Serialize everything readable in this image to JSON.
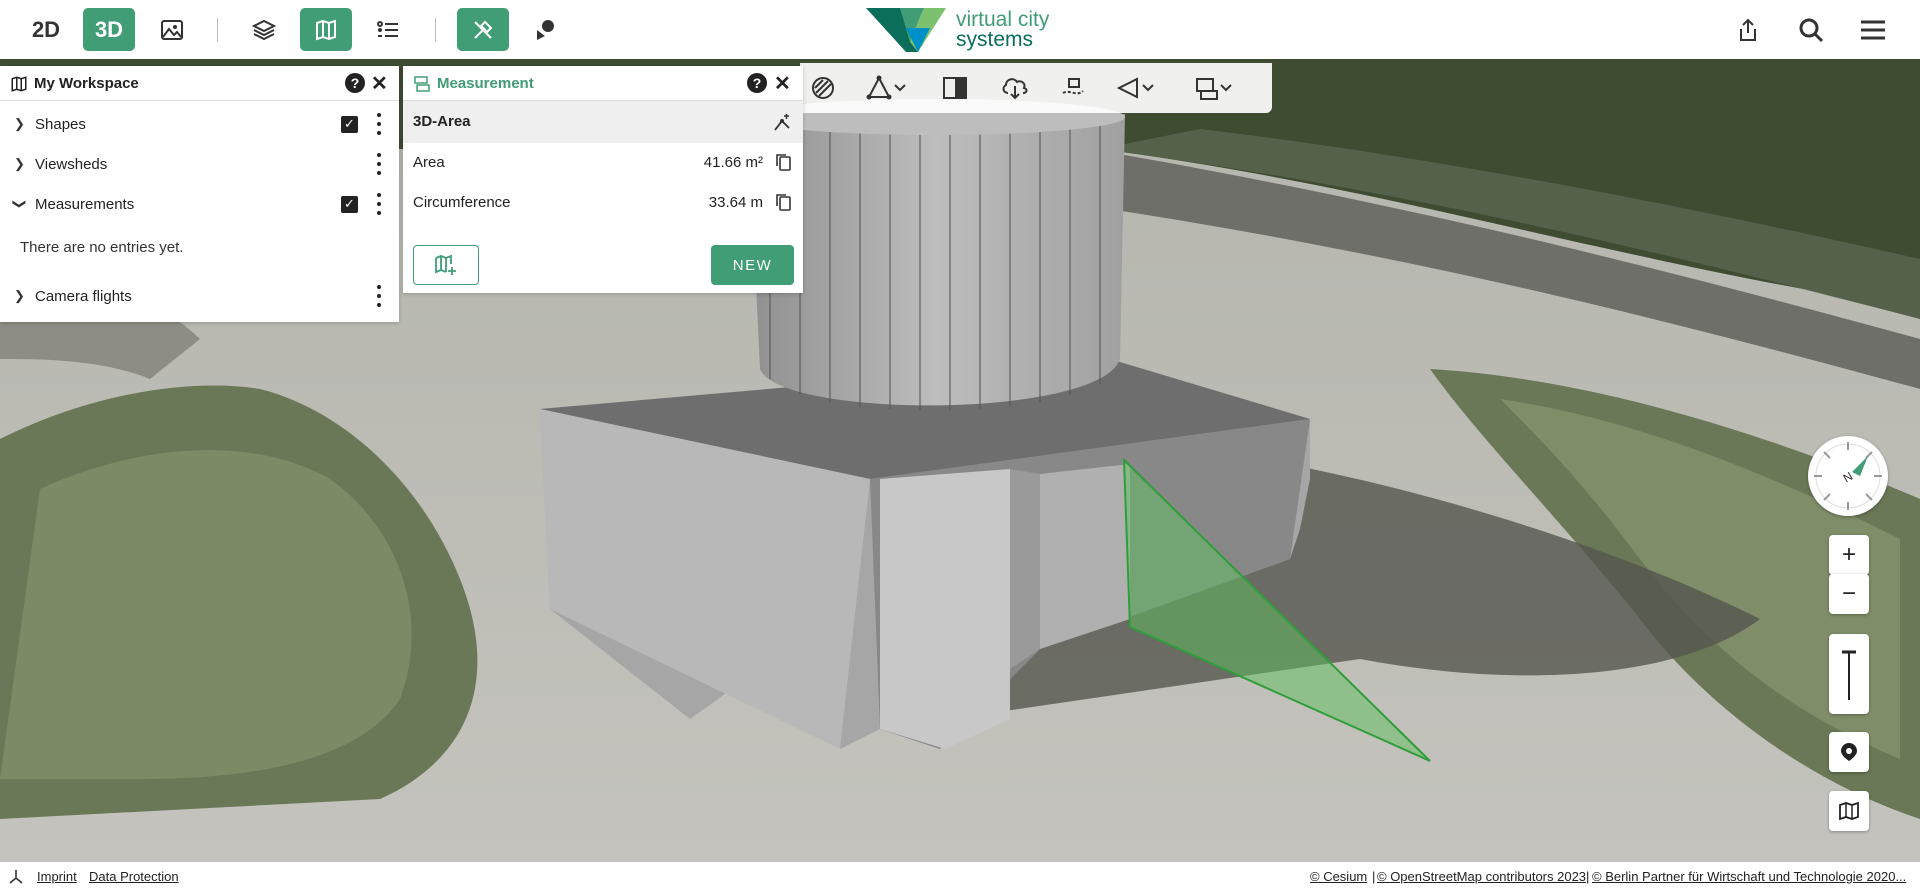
{
  "navbar": {
    "view_2d": "2D",
    "view_3d": "3D",
    "logo_line1": "virtual city",
    "logo_line2": "systems"
  },
  "workspace": {
    "title": "My Workspace",
    "items": [
      {
        "label": "Shapes"
      },
      {
        "label": "Viewsheds"
      },
      {
        "label": "Measurements"
      },
      {
        "label": "Camera flights"
      }
    ],
    "empty_text": "There are no entries yet."
  },
  "measurement": {
    "title": "Measurement",
    "mode": "3D-Area",
    "rows": [
      {
        "label": "Area",
        "value": "41.66 m²"
      },
      {
        "label": "Circumference",
        "value": "33.64 m"
      }
    ],
    "new_button": "NEW"
  },
  "footer": {
    "imprint": "Imprint",
    "data_protection": "Data Protection",
    "cesium": "© Cesium",
    "osm": "© OpenStreetMap contributors 2023",
    "berlin": "© Berlin Partner für Wirtschaft und Technologie 2020..."
  },
  "colors": {
    "accent": "#409d76",
    "measure_fill": "#5dbf5d"
  },
  "icons": {
    "zoom_in": "+",
    "zoom_out": "−"
  }
}
